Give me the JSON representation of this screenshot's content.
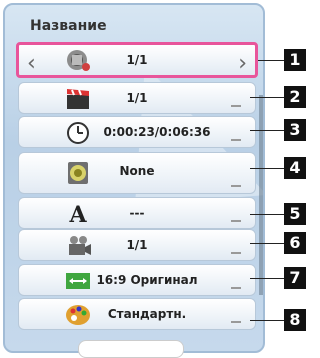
{
  "menu": {
    "title": "Название",
    "rows": [
      {
        "value": "1/1",
        "icon": "angle-icon"
      },
      {
        "value": "1/1",
        "icon": "clapperboard-icon"
      },
      {
        "value": "0:00:23/0:06:36",
        "icon": "clock-icon"
      },
      {
        "value": "None",
        "icon": "speaker-icon"
      },
      {
        "value": "---",
        "icon": "subtitle-icon"
      },
      {
        "value": "1/1",
        "icon": "camera-icon"
      },
      {
        "value": "16:9 Оригинал",
        "icon": "aspect-ratio-icon"
      },
      {
        "value": "Стандартн.",
        "icon": "palette-icon"
      }
    ]
  },
  "callouts": [
    "1",
    "2",
    "3",
    "4",
    "5",
    "6",
    "7",
    "8"
  ],
  "colors": {
    "selection": "#e8559b",
    "panel": "#c6d9ec"
  }
}
